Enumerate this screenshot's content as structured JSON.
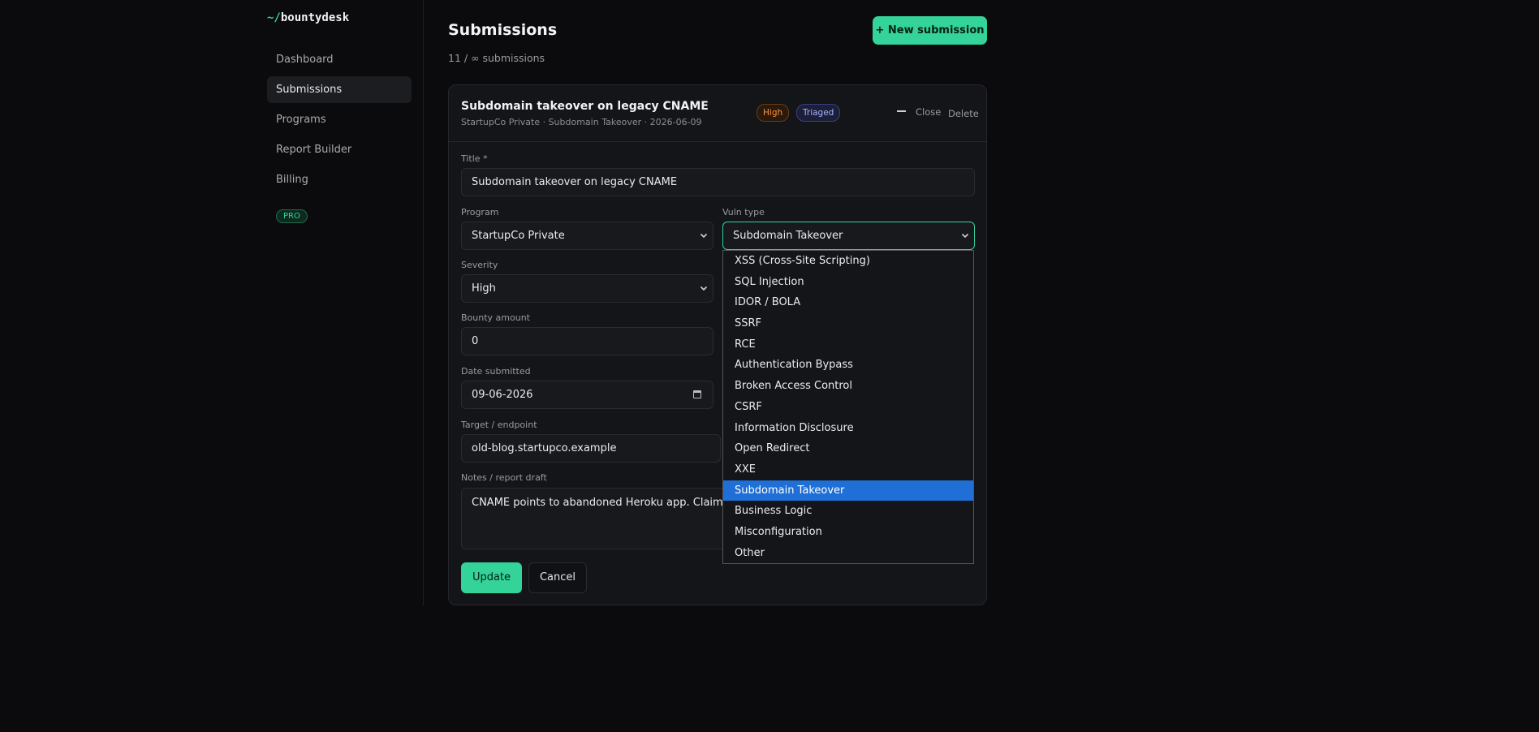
{
  "app": {
    "logo_prefix": "~/",
    "logo_name": "bountydesk",
    "plan_badge": "PRO"
  },
  "sidebar": {
    "items": [
      {
        "label": "Dashboard",
        "active": false
      },
      {
        "label": "Submissions",
        "active": true
      },
      {
        "label": "Programs",
        "active": false
      },
      {
        "label": "Report Builder",
        "active": false
      },
      {
        "label": "Billing",
        "active": false
      }
    ]
  },
  "header": {
    "title": "Submissions",
    "count_text": "11 / ∞ submissions",
    "new_button": "+ New submission"
  },
  "submission": {
    "title": "Subdomain takeover on legacy CNAME",
    "meta": "StartupCo Private · Subdomain Takeover · 2026-06-09",
    "severity_badge": "High",
    "status_badge": "Triaged",
    "close_label": "Close",
    "delete_label": "Delete"
  },
  "form": {
    "title_label": "Title *",
    "title_value": "Subdomain takeover on legacy CNAME",
    "program_label": "Program",
    "program_value": "StartupCo Private",
    "vuln_label": "Vuln type",
    "vuln_value": "Subdomain Takeover",
    "severity_label": "Severity",
    "severity_value": "High",
    "bounty_label": "Bounty amount",
    "bounty_value": "0",
    "date_label": "Date submitted",
    "date_value": "09-06-2026",
    "target_label": "Target / endpoint",
    "target_value": "old-blog.startupco.example",
    "notes_label": "Notes / report draft",
    "notes_value": "CNAME points to abandoned Heroku app. Claimed th",
    "update_button": "Update",
    "cancel_button": "Cancel"
  },
  "vuln_options": [
    "XSS (Cross-Site Scripting)",
    "SQL Injection",
    "IDOR / BOLA",
    "SSRF",
    "RCE",
    "Authentication Bypass",
    "Broken Access Control",
    "CSRF",
    "Information Disclosure",
    "Open Redirect",
    "XXE",
    "Subdomain Takeover",
    "Business Logic",
    "Misconfiguration",
    "Other"
  ],
  "vuln_selected_index": 11,
  "colors": {
    "accent": "#34d399",
    "background": "#0b0b0d",
    "selected_option": "#1f6fd6"
  }
}
